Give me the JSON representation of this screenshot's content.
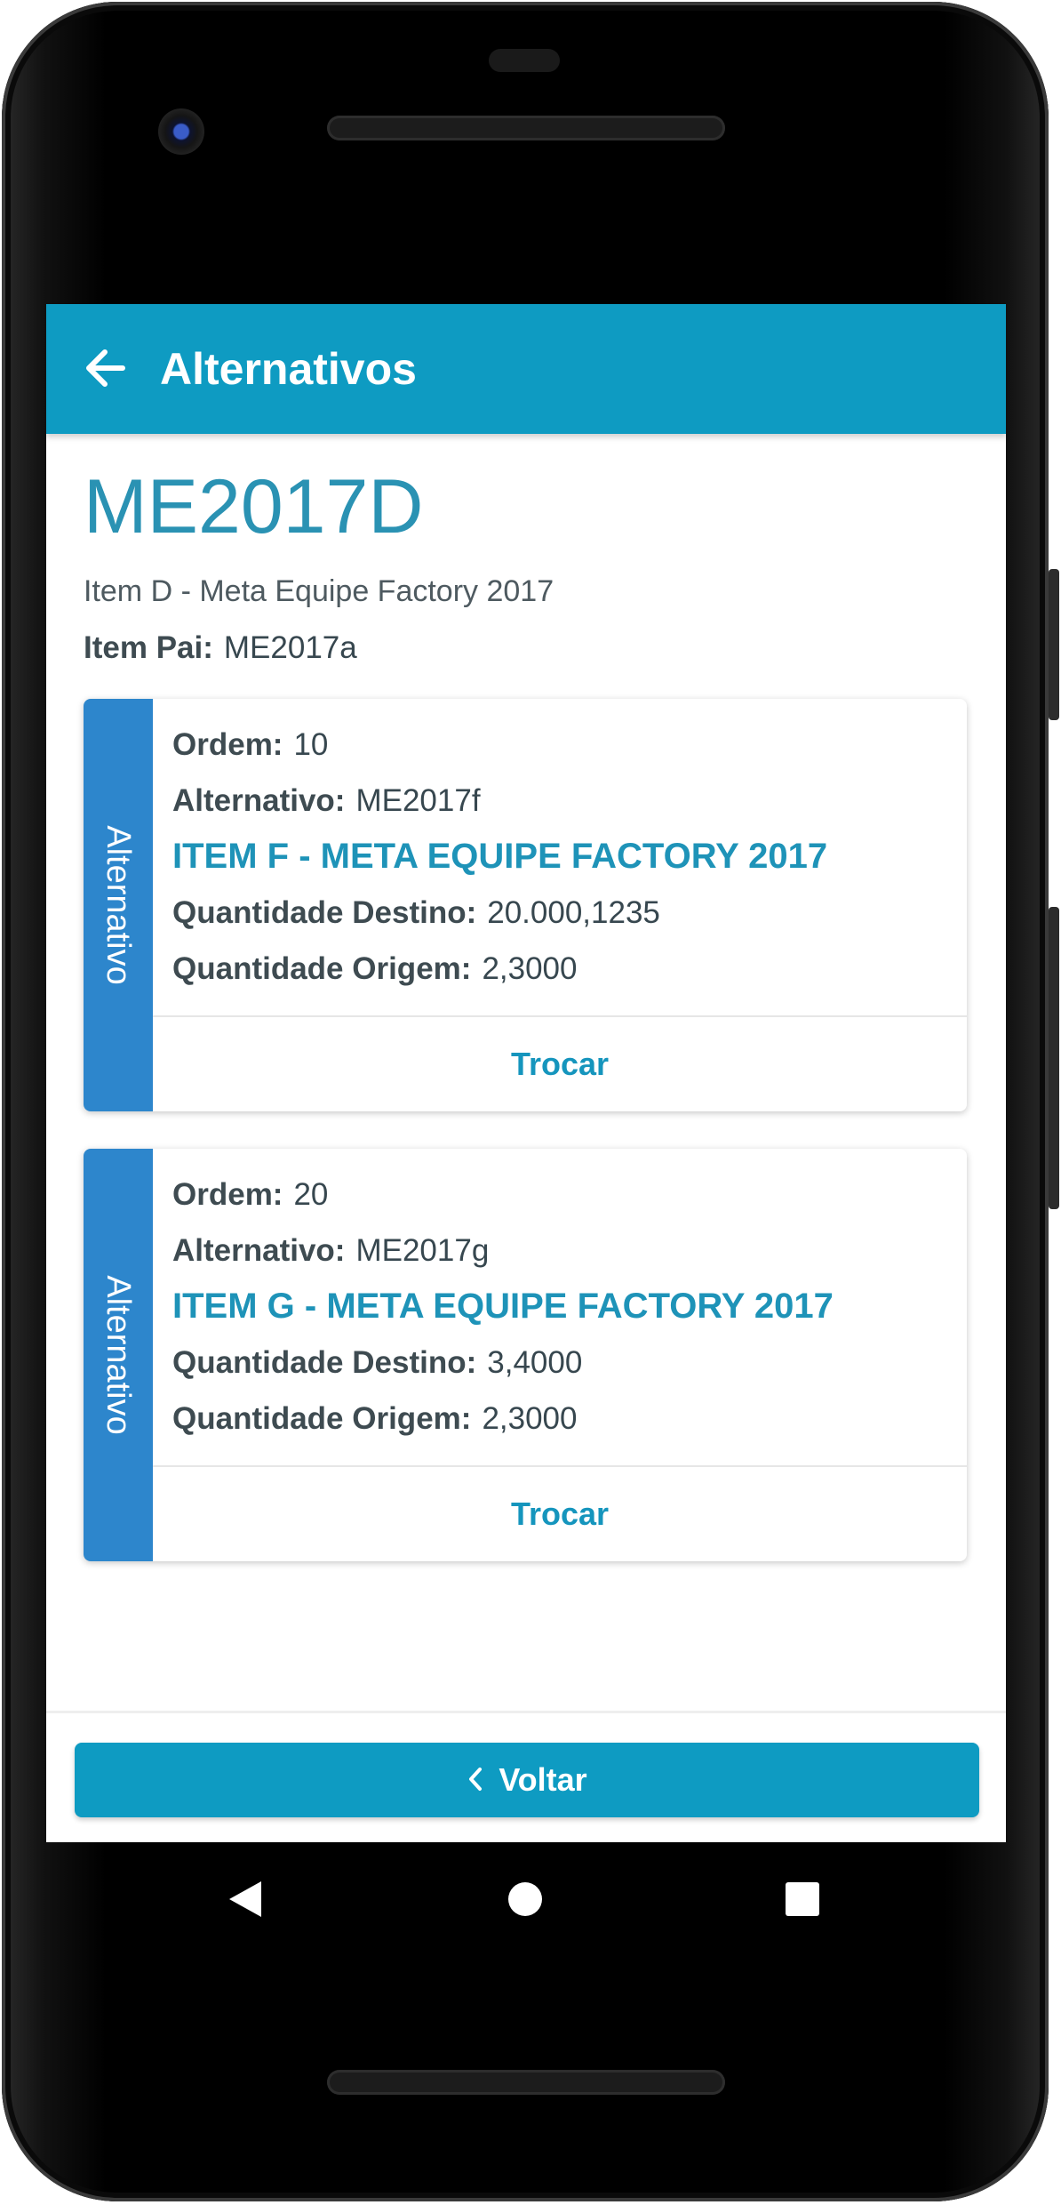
{
  "appbar": {
    "back_icon": "arrow-left-icon",
    "title": "Alternativos"
  },
  "item": {
    "code": "ME2017D",
    "description": "Item D - Meta Equipe Factory 2017",
    "parent_label": "Item Pai:",
    "parent_value": "ME2017a"
  },
  "cards": [
    {
      "side_label": "Alternativo",
      "ordem_label": "Ordem:",
      "ordem_value": "10",
      "alternativo_label": "Alternativo:",
      "alternativo_value": "ME2017f",
      "title": "ITEM F - META EQUIPE FACTORY 2017",
      "destino_label": "Quantidade Destino:",
      "destino_value": "20.000,1235",
      "origem_label": "Quantidade Origem:",
      "origem_value": "2,3000",
      "action_label": "Trocar"
    },
    {
      "side_label": "Alternativo",
      "ordem_label": "Ordem:",
      "ordem_value": "20",
      "alternativo_label": "Alternativo:",
      "alternativo_value": "ME2017g",
      "title": "ITEM G - META EQUIPE FACTORY 2017",
      "destino_label": "Quantidade Destino:",
      "destino_value": "3,4000",
      "origem_label": "Quantidade Origem:",
      "origem_value": "2,3000",
      "action_label": "Trocar"
    }
  ],
  "footer": {
    "back_label": "Voltar",
    "back_icon": "chevron-left-icon"
  },
  "navigation": {
    "icons": [
      "nav-back-icon",
      "nav-home-icon",
      "nav-recents-icon"
    ]
  },
  "colors": {
    "primary": "#0e9bc2",
    "card_side": "#2d86cc",
    "accent_text": "#1e93b8"
  }
}
